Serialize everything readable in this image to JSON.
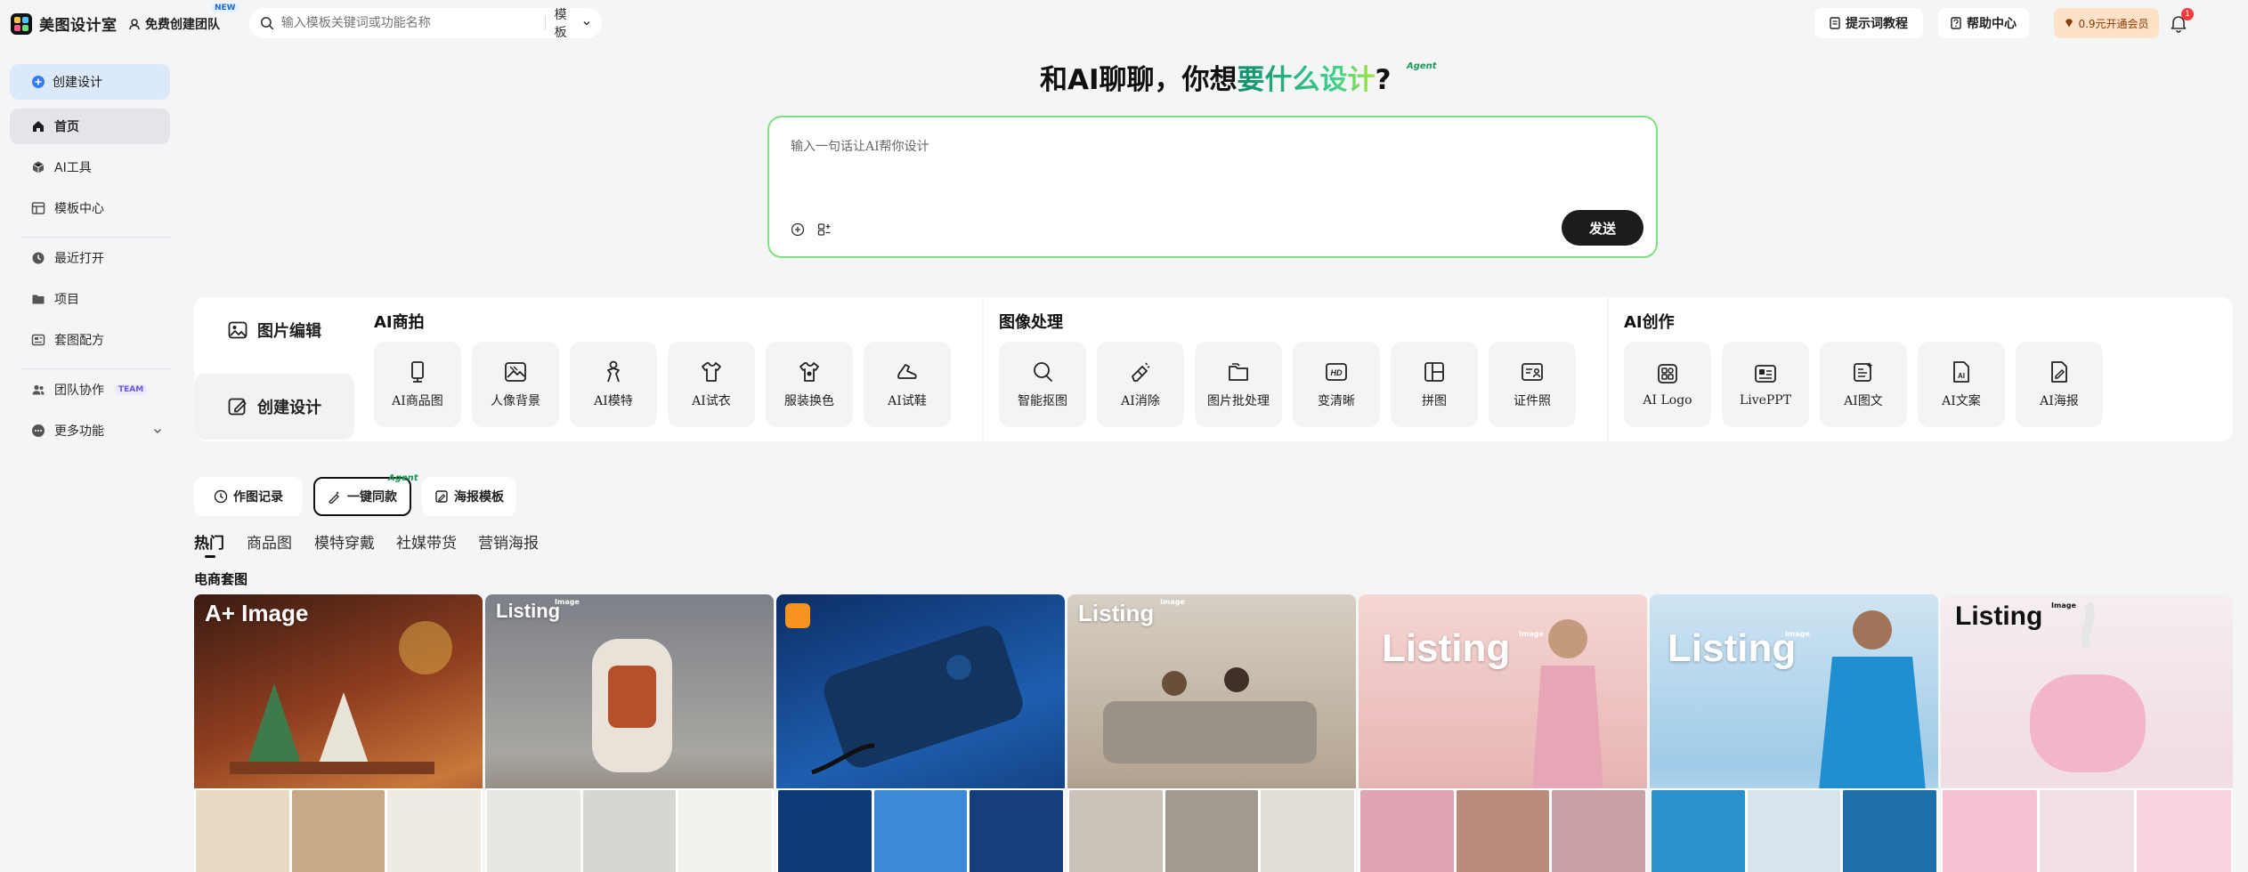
{
  "app": {
    "name": "美图设计室",
    "team_link": "免费创建团队",
    "new_badge": "NEW",
    "search_placeholder": "输入模板关键词或功能名称",
    "search_type": "模板",
    "tutorial_btn": "提示词教程",
    "help_btn": "帮助中心",
    "vip_btn": "0.9元开通会员",
    "notif_count": "1"
  },
  "sidebar": {
    "create": "创建设计",
    "items": [
      "首页",
      "AI工具",
      "模板中心",
      "最近打开",
      "项目",
      "套图配方",
      "团队协作",
      "更多功能"
    ],
    "team_tag": "TEAM"
  },
  "hero": {
    "title_a": "和AI聊聊，你想",
    "title_accent": "要什么设计",
    "title_b": "?",
    "agent": "Agent",
    "prompt_placeholder": "输入一句话让AI帮你设计",
    "send": "发送"
  },
  "tabs_left": {
    "active": "图片编辑",
    "inactive": "创建设计"
  },
  "tool_groups": [
    {
      "title": "AI商拍",
      "items": [
        "AI商品图",
        "人像背景",
        "AI模特",
        "AI试衣",
        "服装换色",
        "AI试鞋"
      ]
    },
    {
      "title": "图像处理",
      "items": [
        "智能抠图",
        "AI消除",
        "图片批处理",
        "变清晰",
        "拼图",
        "证件照"
      ]
    },
    {
      "title": "AI创作",
      "items": [
        "AI Logo",
        "LivePPT",
        "AI图文",
        "AI文案",
        "AI海报"
      ]
    }
  ],
  "chips": [
    "作图记录",
    "一键同款",
    "海报模板"
  ],
  "chip_agent": "Agent",
  "categories": [
    "热门",
    "商品图",
    "模特穿戴",
    "社媒带货",
    "营销海报"
  ],
  "section_title": "电商套图",
  "thumbnails": [
    {
      "title": "A+ Image",
      "sub": "",
      "bg": "#6b2a1c"
    },
    {
      "title": "Listing",
      "sub": "Image",
      "bg": "#8a8f96"
    },
    {
      "title": "",
      "sub": "",
      "bg": "#1b4a8a"
    },
    {
      "title": "Listing",
      "sub": "Image",
      "bg": "#b9ab98"
    },
    {
      "title": "Listing",
      "sub": "Image",
      "bg": "#f1c9c9"
    },
    {
      "title": "Listing",
      "sub": "Image",
      "bg": "#9fcbe8"
    },
    {
      "title": "Listing",
      "sub": "Image",
      "bg": "#f3e6ea"
    }
  ],
  "colors": {
    "accent_blue": "#dce9fb",
    "prompt_border": "#7fe07f",
    "send_bg": "#1c1c1c",
    "vip_bg": "#fde1c8"
  }
}
